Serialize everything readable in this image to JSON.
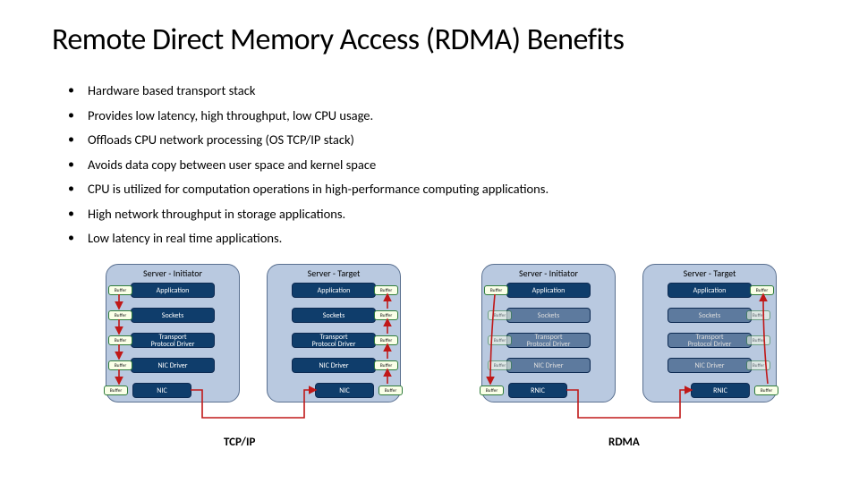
{
  "title": "Remote Direct Memory Access (RDMA) Benefits",
  "bullets": [
    "Hardware based transport stack",
    "Provides low latency, high throughput, low CPU usage.",
    "Offloads CPU network processing (OS TCP/IP stack)",
    "Avoids data copy between user space and kernel space",
    "CPU is utilized for computation operations in high-performance computing applications.",
    "High network throughput in storage applications.",
    "Low latency in real time applications."
  ],
  "layers": {
    "app": "Application",
    "sockets": "Sockets",
    "transport": "Transport\nProtocol Driver",
    "nicdrv": "NIC Driver",
    "nic": "NIC",
    "rnic": "RNIC"
  },
  "buffer_label": "Buffer",
  "server_titles": {
    "initiator": "Server - Initiator",
    "target": "Server - Target"
  },
  "bottom_labels": {
    "tcpip": "TCP/IP",
    "rdma": "RDMA"
  },
  "colors": {
    "server_fill": "#b9c9e0",
    "active_layer": "#0f3d6b",
    "muted_layer": "#5d7a9e",
    "arrow": "#c01818",
    "buffer_border": "#2f7c3a"
  }
}
